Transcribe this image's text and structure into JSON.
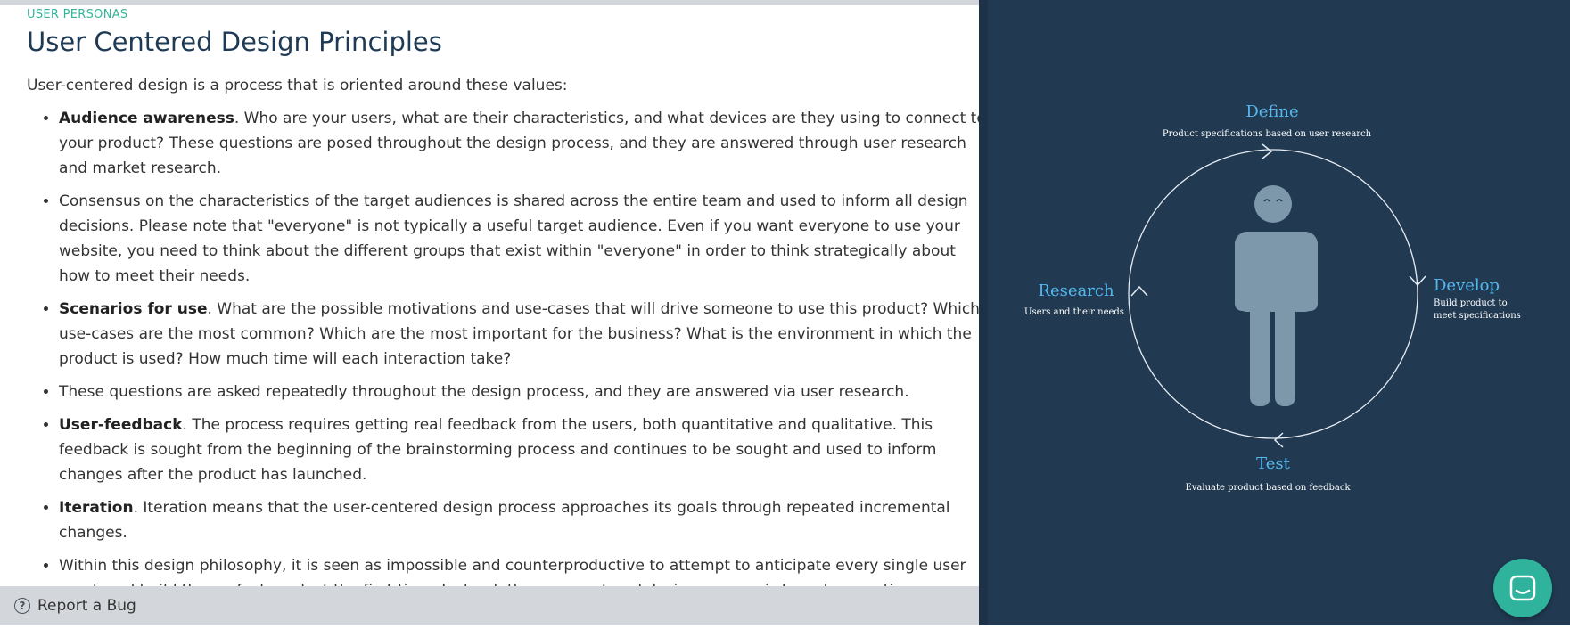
{
  "section_label": "USER PERSONAS",
  "page_title": "User Centered Design Principles",
  "intro": "User-centered design is a process that is oriented around these values:",
  "bullets": [
    {
      "lead": "Audience awareness",
      "text": ". Who are your users, what are their characteristics, and what devices are they using to connect to your product? These questions are posed throughout the design process, and they are answered through user research and market research."
    },
    {
      "lead": "",
      "text": "Consensus on the characteristics of the target audiences is shared across the entire team and used to inform all design decisions. Please note that \"everyone\" is not typically a useful target audience. Even if you want everyone to use your website, you need to think about the different groups that exist within \"everyone\" in order to think strategically about how to meet their needs."
    },
    {
      "lead": "Scenarios for use",
      "text": ". What are the possible motivations and use-cases that will drive someone to use this product? Which use-cases are the most common? Which are the most important for the business? What is the environment in which the product is used? How much time will each interaction take?"
    },
    {
      "lead": "",
      "text": "These questions are asked repeatedly throughout the design process, and they are answered via user research."
    },
    {
      "lead": "User-feedback",
      "text": ". The process requires getting real feedback from the users, both quantitative and qualitative. This feedback is sought from the beginning of the brainstorming process and continues to be sought and used to inform changes after the product has launched."
    },
    {
      "lead": "Iteration",
      "text": ". Iteration means that the user-centered design process approaches its goals through repeated incremental changes."
    },
    {
      "lead": "",
      "text": "Within this design philosophy, it is seen as impossible and counterproductive to attempt to anticipate every single user need, and build the perfect product the first time. Instead, the user-centered design process is based on continuous iteration centered on the real behaviors and feedback from your users."
    }
  ],
  "footer": {
    "help_glyph": "?",
    "report_label": "Report a Bug"
  },
  "diagram": {
    "define": {
      "title": "Define",
      "caption": "Product specifications based on user research"
    },
    "develop": {
      "title": "Develop",
      "caption_line1": "Build product to",
      "caption_line2": "meet specifications"
    },
    "test": {
      "title": "Test",
      "caption": "Evaluate product based on feedback"
    },
    "research": {
      "title": "Research",
      "caption": "Users and their needs"
    },
    "icon": "person-icon"
  },
  "colors": {
    "accent": "#35b39a",
    "heading": "#1f3a55",
    "panel_bg": "#213a52",
    "diagram_title": "#54b8ef",
    "person": "#7d97ab",
    "chat_button": "#2fb39c"
  }
}
